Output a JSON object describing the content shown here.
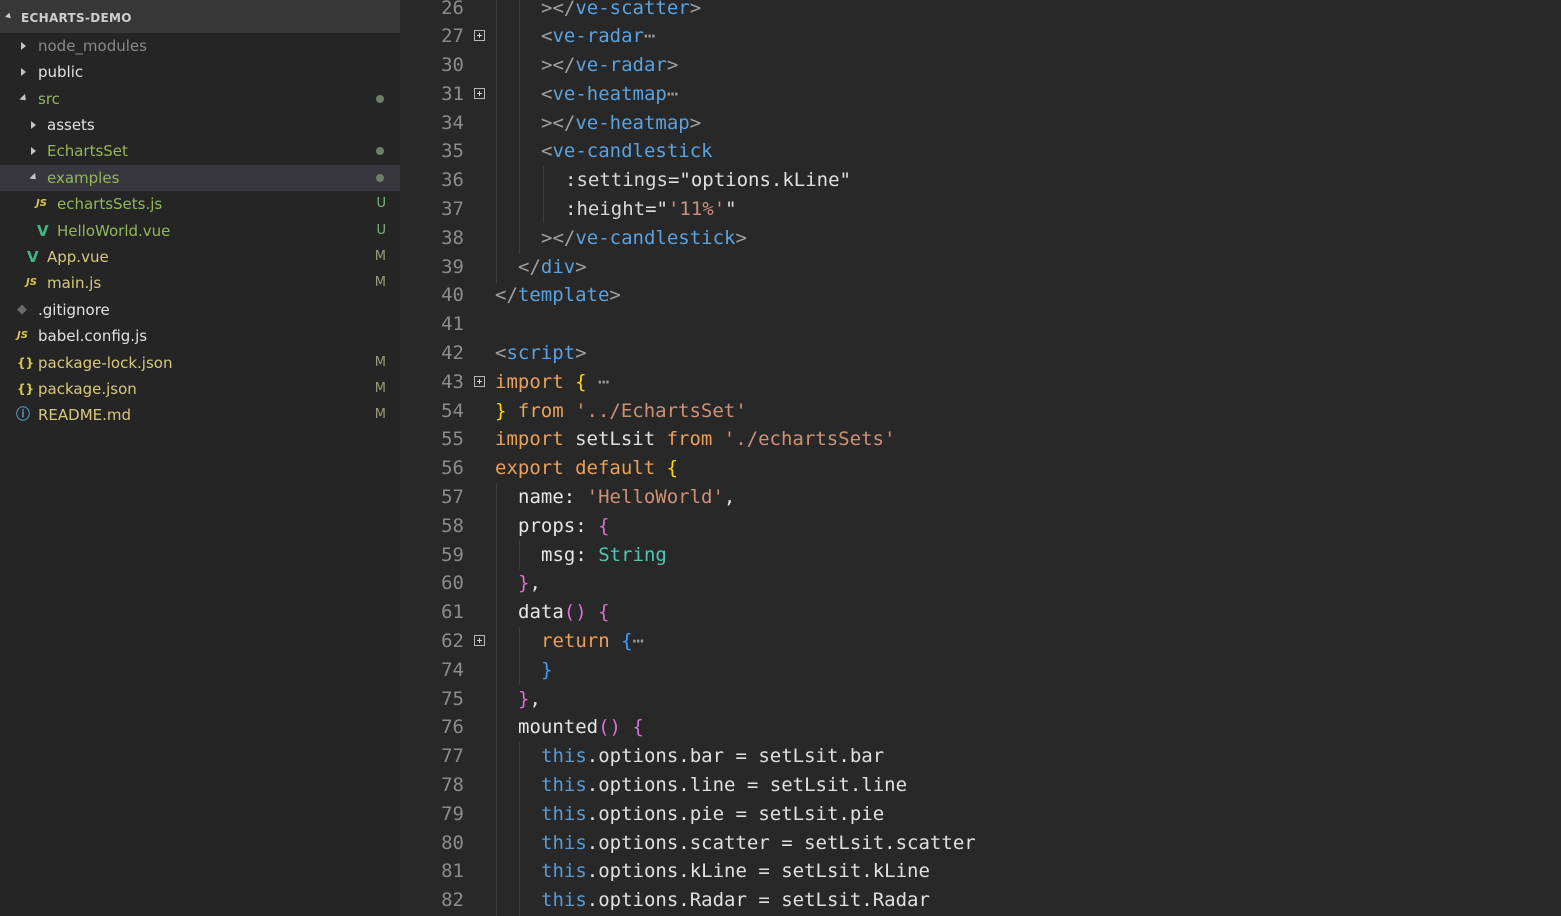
{
  "explorer": {
    "title": "ECHARTS-DEMO",
    "items": [
      {
        "label": "node_modules",
        "badge": ""
      },
      {
        "label": "public",
        "badge": ""
      },
      {
        "label": "src",
        "badge": ""
      },
      {
        "label": "assets",
        "badge": ""
      },
      {
        "label": "EchartsSet",
        "badge": ""
      },
      {
        "label": "examples",
        "badge": ""
      },
      {
        "label": "echartsSets.js",
        "icon": "JS",
        "badge": "U"
      },
      {
        "label": "HelloWorld.vue",
        "icon": "V",
        "badge": "U"
      },
      {
        "label": "App.vue",
        "icon": "V",
        "badge": "M"
      },
      {
        "label": "main.js",
        "icon": "JS",
        "badge": "M"
      },
      {
        "label": ".gitignore",
        "icon": "◆",
        "badge": ""
      },
      {
        "label": "babel.config.js",
        "icon": "JS",
        "badge": ""
      },
      {
        "label": "package-lock.json",
        "icon": "{}",
        "badge": "M"
      },
      {
        "label": "package.json",
        "icon": "{}",
        "badge": "M"
      },
      {
        "label": "README.md",
        "icon": "ⓘ",
        "badge": "M"
      }
    ]
  },
  "editor": {
    "lines": [
      {
        "n": "26",
        "t": [
          [
            "t-punc",
            "></"
          ],
          [
            "t-tag",
            "ve-scatter"
          ],
          [
            "t-punc",
            ">"
          ]
        ]
      },
      {
        "n": "27",
        "t": [
          [
            "t-punc",
            "<"
          ],
          [
            "t-tag",
            "ve-radar"
          ],
          [
            "t-ell",
            "⋯"
          ]
        ]
      },
      {
        "n": "30",
        "t": [
          [
            "t-punc",
            "></"
          ],
          [
            "t-tag",
            "ve-radar"
          ],
          [
            "t-punc",
            ">"
          ]
        ]
      },
      {
        "n": "31",
        "t": [
          [
            "t-punc",
            "<"
          ],
          [
            "t-tag",
            "ve-heatmap"
          ],
          [
            "t-ell",
            "⋯"
          ]
        ]
      },
      {
        "n": "34",
        "t": [
          [
            "t-punc",
            "></"
          ],
          [
            "t-tag",
            "ve-heatmap"
          ],
          [
            "t-punc",
            ">"
          ]
        ]
      },
      {
        "n": "35",
        "t": [
          [
            "t-punc",
            "<"
          ],
          [
            "t-tag",
            "ve-candlestick"
          ]
        ]
      },
      {
        "n": "36",
        "t": [
          [
            "t-attr",
            ":settings"
          ],
          [
            "t-plain",
            "=\"options.kLine\""
          ]
        ]
      },
      {
        "n": "37",
        "t": [
          [
            "t-attr",
            ":height"
          ],
          [
            "t-plain",
            "=\""
          ],
          [
            "t-str",
            "'11%'"
          ],
          [
            "t-plain",
            "\""
          ]
        ]
      },
      {
        "n": "38",
        "t": [
          [
            "t-punc",
            "></"
          ],
          [
            "t-tag",
            "ve-candlestick"
          ],
          [
            "t-punc",
            ">"
          ]
        ]
      },
      {
        "n": "39",
        "t": [
          [
            "t-punc",
            "</"
          ],
          [
            "t-tag",
            "div"
          ],
          [
            "t-punc",
            ">"
          ]
        ]
      },
      {
        "n": "40",
        "t": [
          [
            "t-punc",
            "</"
          ],
          [
            "t-tag",
            "template"
          ],
          [
            "t-punc",
            ">"
          ]
        ]
      },
      {
        "n": "41",
        "t": []
      },
      {
        "n": "42",
        "t": [
          [
            "t-punc",
            "<"
          ],
          [
            "t-tag",
            "script"
          ],
          [
            "t-punc",
            ">"
          ]
        ]
      },
      {
        "n": "43",
        "t": [
          [
            "t-kw",
            "import "
          ],
          [
            "t-brace1",
            "{"
          ],
          [
            "t-ell",
            " ⋯"
          ]
        ]
      },
      {
        "n": "54",
        "t": [
          [
            "t-brace1",
            "}"
          ],
          [
            "t-kw",
            " from "
          ],
          [
            "t-str",
            "'../EchartsSet'"
          ]
        ]
      },
      {
        "n": "55",
        "t": [
          [
            "t-kw",
            "import "
          ],
          [
            "t-plain",
            "setLsit"
          ],
          [
            "t-kw",
            " from "
          ],
          [
            "t-str",
            "'./echartsSets'"
          ]
        ]
      },
      {
        "n": "56",
        "t": [
          [
            "t-kw",
            "export default "
          ],
          [
            "t-brace1",
            "{"
          ]
        ]
      },
      {
        "n": "57",
        "t": [
          [
            "t-prop",
            "name: "
          ],
          [
            "t-str",
            "'HelloWorld'"
          ],
          [
            "t-plain",
            ","
          ]
        ]
      },
      {
        "n": "58",
        "t": [
          [
            "t-prop",
            "props: "
          ],
          [
            "t-brace2",
            "{"
          ]
        ]
      },
      {
        "n": "59",
        "t": [
          [
            "t-prop",
            "msg: "
          ],
          [
            "t-type",
            "String"
          ]
        ]
      },
      {
        "n": "60",
        "t": [
          [
            "t-brace2",
            "}"
          ],
          [
            "t-plain",
            ","
          ]
        ]
      },
      {
        "n": "61",
        "t": [
          [
            "t-prop",
            "data"
          ],
          [
            "t-brace2",
            "() {"
          ]
        ]
      },
      {
        "n": "62",
        "t": [
          [
            "t-kw",
            "return "
          ],
          [
            "t-brace3",
            "{"
          ],
          [
            "t-ell",
            "⋯"
          ]
        ]
      },
      {
        "n": "74",
        "t": [
          [
            "t-brace3",
            "}"
          ]
        ]
      },
      {
        "n": "75",
        "t": [
          [
            "t-brace2",
            "}"
          ],
          [
            "t-plain",
            ","
          ]
        ]
      },
      {
        "n": "76",
        "t": [
          [
            "t-prop",
            "mounted"
          ],
          [
            "t-brace2",
            "() {"
          ]
        ]
      },
      {
        "n": "77",
        "t": [
          [
            "t-this",
            "this"
          ],
          [
            "t-plain",
            ".options.bar = setLsit.bar"
          ]
        ]
      },
      {
        "n": "78",
        "t": [
          [
            "t-this",
            "this"
          ],
          [
            "t-plain",
            ".options.line = setLsit.line"
          ]
        ]
      },
      {
        "n": "79",
        "t": [
          [
            "t-this",
            "this"
          ],
          [
            "t-plain",
            ".options.pie = setLsit.pie"
          ]
        ]
      },
      {
        "n": "80",
        "t": [
          [
            "t-this",
            "this"
          ],
          [
            "t-plain",
            ".options.scatter = setLsit.scatter"
          ]
        ]
      },
      {
        "n": "81",
        "t": [
          [
            "t-this",
            "this"
          ],
          [
            "t-plain",
            ".options.kLine = setLsit.kLine"
          ]
        ]
      },
      {
        "n": "82",
        "t": [
          [
            "t-this",
            "this"
          ],
          [
            "t-plain",
            ".options.Radar = setLsit.Radar"
          ]
        ]
      }
    ]
  }
}
